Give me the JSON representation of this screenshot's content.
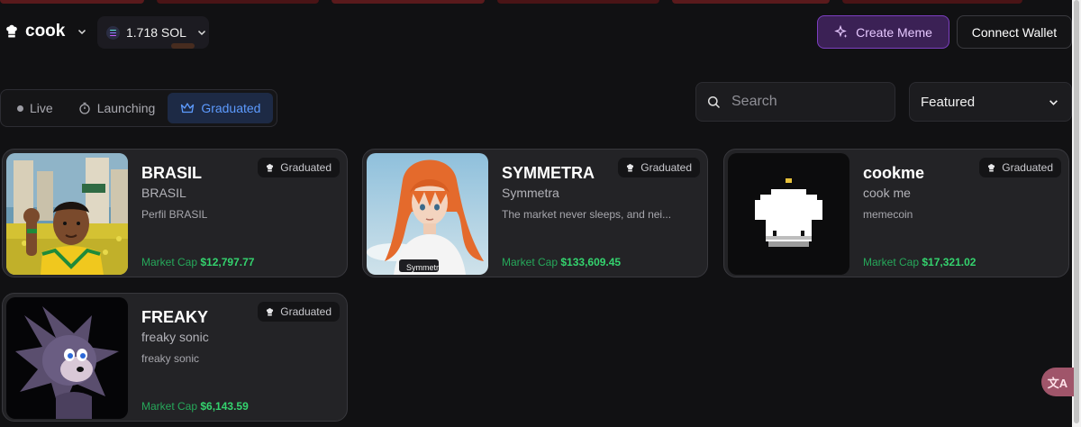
{
  "top_strip_colors": [
    "#5a1a1c",
    "#4a1416",
    "#5a1a1c",
    "#4a1416",
    "#5a1a1c",
    "#4a1416"
  ],
  "header": {
    "logo_text": "cook",
    "logo_icon": "chef-hat-icon",
    "wallet_balance": "1.718 SOL",
    "balance_icon": "solana-icon",
    "create_label": "Create Meme",
    "create_icon": "sparkle-icon",
    "connect_label": "Connect Wallet"
  },
  "tabs": [
    {
      "label": "Live",
      "icon": "dot-icon",
      "active": false
    },
    {
      "label": "Launching",
      "icon": "stopwatch-icon",
      "active": false
    },
    {
      "label": "Graduated",
      "icon": "crown-icon",
      "active": true
    }
  ],
  "search": {
    "placeholder": "Search"
  },
  "sort": {
    "selected": "Featured"
  },
  "colors": {
    "accent_blue": "#5d9bff",
    "accent_purple": "#7c3fc0",
    "market_cap_green": "#34d36e"
  },
  "cards": [
    {
      "name": "BRASIL",
      "ticker": "BRASIL",
      "description": "Perfil BRASIL",
      "badge": "Graduated",
      "market_cap_label": "Market Cap",
      "market_cap": "$12,797.77",
      "image": "cartoon-man-brazil-flag-city"
    },
    {
      "name": "SYMMETRA",
      "ticker": "Symmetra",
      "description": "The market never sleeps, and nei...",
      "badge": "Graduated",
      "market_cap_label": "Market Cap",
      "market_cap": "$133,609.45",
      "image": "anime-girl-orange-hair",
      "image_caption": "Symmetry"
    },
    {
      "name": "cookme",
      "ticker": "cook me",
      "description": "memecoin",
      "badge": "Graduated",
      "market_cap_label": "Market Cap",
      "market_cap": "$17,321.02",
      "image": "pixel-chef-hat"
    },
    {
      "name": "FREAKY",
      "ticker": "freaky sonic",
      "description": "freaky sonic",
      "badge": "Graduated",
      "market_cap_label": "Market Cap",
      "market_cap": "$6,143.59",
      "image": "purple-hedgehog-3d"
    }
  ],
  "translate_button": {
    "label": "文A"
  }
}
